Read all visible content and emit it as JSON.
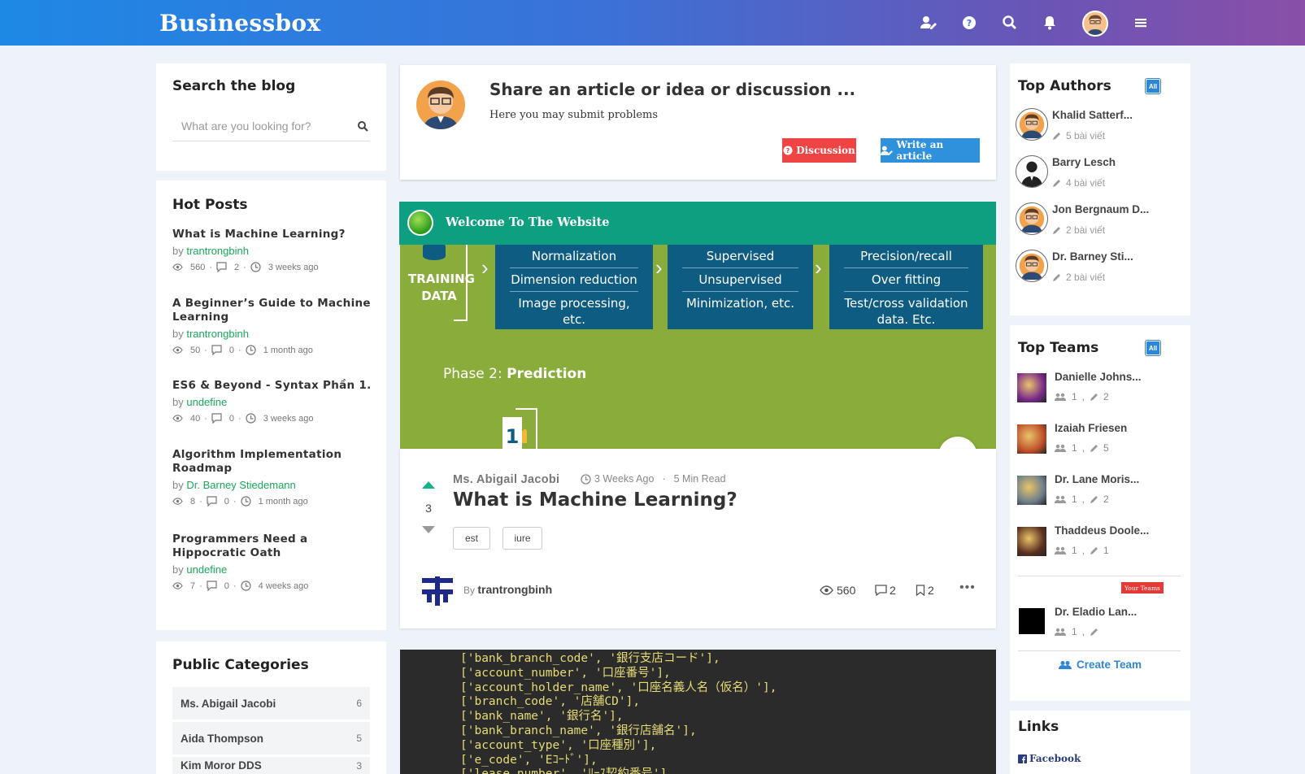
{
  "brand": "Businessbox",
  "header": {
    "icons": [
      "user-edit-icon",
      "question-icon",
      "search-icon",
      "bell-icon",
      "avatar",
      "menu-icon"
    ]
  },
  "search": {
    "title": "Search the blog",
    "placeholder": "What are you looking for?"
  },
  "hot_posts": {
    "title": "Hot Posts",
    "items": [
      {
        "title": "What is Machine Learning?",
        "by": "by",
        "author": "trantrongbinh",
        "views": "560",
        "comments": "2",
        "time": "3 weeks ago"
      },
      {
        "title": "A Beginner’s Guide to Machine Learning",
        "by": "by",
        "author": "trantrongbinh",
        "views": "50",
        "comments": "0",
        "time": "1 month ago"
      },
      {
        "title": "ES6 & Beyond - Syntax Phần 1.",
        "by": "by",
        "author": "undefine",
        "views": "40",
        "comments": "0",
        "time": "3 weeks ago"
      },
      {
        "title": "Algorithm Implementation Roadmap",
        "by": "by",
        "author": "Dr. Barney Stiedemann",
        "views": "8",
        "comments": "0",
        "time": "1 month ago"
      },
      {
        "title": "Programmers Need a Hippocratic Oath",
        "by": "by",
        "author": "undefine",
        "views": "7",
        "comments": "0",
        "time": "4 weeks ago"
      }
    ]
  },
  "categories": {
    "title": "Public Categories",
    "items": [
      {
        "name": "Ms. Abigail Jacobi",
        "count": "6"
      },
      {
        "name": "Aida Thompson",
        "count": "5"
      },
      {
        "name": "Kim Moror DDS",
        "count": "3"
      }
    ]
  },
  "share": {
    "title": "Share an article or idea or discussion ...",
    "subtitle": "Here you may submit problems",
    "discussion_btn": "Discussion",
    "write_btn": "Write an article"
  },
  "welcome": "Welcome To The Website",
  "hero": {
    "training": [
      "TRAINING",
      "DATA"
    ],
    "col1": [
      "Normalization",
      "Dimension reduction",
      "Image processing, etc."
    ],
    "col2": [
      "Supervised",
      "Unsupervised",
      "Minimization, etc."
    ],
    "col3": [
      "Precision/recall",
      "Over fitting",
      "Test/cross validation data. Etc."
    ],
    "phase_prefix": "Phase 2: ",
    "phase_bold": "Prediction"
  },
  "article": {
    "author": "Ms. Abigail Jacobi",
    "time": "3 Weeks Ago",
    "read": "5 Min Read",
    "votes": "3",
    "title": "What is Machine Learning?",
    "tags": [
      "est",
      "iure"
    ],
    "by_prefix": "By",
    "by": "trantrongbinh",
    "views": "560",
    "comments": "2",
    "bookmarks": "2"
  },
  "code_lines": [
    "['bank_branch_code', '銀行支店コード'],",
    "['account_number', '口座番号'],",
    "['account_holder_name', '口座名義人名（仮名）'],",
    "['branch_code', '店舗CD'],",
    "['bank_name', '銀行名'],",
    "['bank_branch_name', '銀行店舗名'],",
    "['account_type', '口座種別'],",
    "['e_code', 'Eｺｰﾄﾞ'],",
    "['lease_number', 'ﾘｰｽ契約番号']"
  ],
  "top_authors": {
    "title": "Top Authors",
    "badge": "All",
    "items": [
      {
        "name": "Khalid Satterf...",
        "posts": "5 bài viết"
      },
      {
        "name": "Barry Lesch",
        "posts": "4 bài viết"
      },
      {
        "name": "Jon Bergnaum D...",
        "posts": "2 bài viết"
      },
      {
        "name": "Dr. Barney Sti...",
        "posts": "2 bài viết"
      }
    ]
  },
  "top_teams": {
    "title": "Top Teams",
    "badge": "All",
    "items": [
      {
        "name": "Danielle Johns...",
        "members": "1",
        "posts": "2",
        "sep": ",",
        "color": "#7a2a8a"
      },
      {
        "name": "Izaiah Friesen",
        "members": "1",
        "posts": "5",
        "sep": ",",
        "color": "#c0502a"
      },
      {
        "name": "Dr. Lane Moris...",
        "members": "1",
        "posts": "2",
        "sep": ",",
        "color": "#6d7f8a"
      },
      {
        "name": "Thaddeus Doole...",
        "members": "1",
        "posts": "1",
        "sep": ",",
        "color": "#5a3020"
      }
    ],
    "your_team_badge": "Your Teams",
    "your_team": {
      "name": "Dr. Eladio Lan...",
      "members": "1",
      "sep": ",",
      "posts": ""
    },
    "create": "Create Team"
  },
  "links": {
    "title": "Links",
    "facebook": "Facebook"
  }
}
